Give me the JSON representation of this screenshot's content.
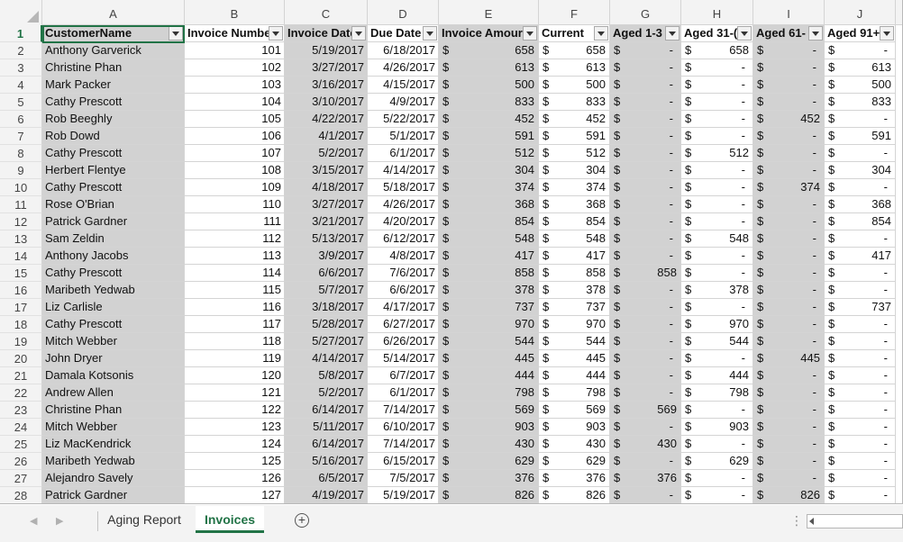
{
  "columns": [
    "A",
    "B",
    "C",
    "D",
    "E",
    "F",
    "G",
    "H",
    "I",
    "J"
  ],
  "headers": [
    "CustomerName",
    "Invoice Numbe",
    "Invoice Date",
    "Due Date",
    "Invoice Amour",
    "Current",
    "Aged 1-3",
    "Aged 31-(",
    "Aged 61-",
    "Aged 91+"
  ],
  "currency_symbol": "$",
  "rows": [
    [
      "Anthony Garverick",
      "101",
      "5/19/2017",
      "6/18/2017",
      "658",
      "658",
      "-",
      "658",
      "-",
      "-"
    ],
    [
      "Christine Phan",
      "102",
      "3/27/2017",
      "4/26/2017",
      "613",
      "613",
      "-",
      "-",
      "-",
      "613"
    ],
    [
      "Mark Packer",
      "103",
      "3/16/2017",
      "4/15/2017",
      "500",
      "500",
      "-",
      "-",
      "-",
      "500"
    ],
    [
      "Cathy Prescott",
      "104",
      "3/10/2017",
      "4/9/2017",
      "833",
      "833",
      "-",
      "-",
      "-",
      "833"
    ],
    [
      "Rob Beeghly",
      "105",
      "4/22/2017",
      "5/22/2017",
      "452",
      "452",
      "-",
      "-",
      "452",
      "-"
    ],
    [
      "Rob Dowd",
      "106",
      "4/1/2017",
      "5/1/2017",
      "591",
      "591",
      "-",
      "-",
      "-",
      "591"
    ],
    [
      "Cathy Prescott",
      "107",
      "5/2/2017",
      "6/1/2017",
      "512",
      "512",
      "-",
      "512",
      "-",
      "-"
    ],
    [
      "Herbert Flentye",
      "108",
      "3/15/2017",
      "4/14/2017",
      "304",
      "304",
      "-",
      "-",
      "-",
      "304"
    ],
    [
      "Cathy Prescott",
      "109",
      "4/18/2017",
      "5/18/2017",
      "374",
      "374",
      "-",
      "-",
      "374",
      "-"
    ],
    [
      "Rose O'Brian",
      "110",
      "3/27/2017",
      "4/26/2017",
      "368",
      "368",
      "-",
      "-",
      "-",
      "368"
    ],
    [
      "Patrick Gardner",
      "111",
      "3/21/2017",
      "4/20/2017",
      "854",
      "854",
      "-",
      "-",
      "-",
      "854"
    ],
    [
      "Sam Zeldin",
      "112",
      "5/13/2017",
      "6/12/2017",
      "548",
      "548",
      "-",
      "548",
      "-",
      "-"
    ],
    [
      "Anthony Jacobs",
      "113",
      "3/9/2017",
      "4/8/2017",
      "417",
      "417",
      "-",
      "-",
      "-",
      "417"
    ],
    [
      "Cathy Prescott",
      "114",
      "6/6/2017",
      "7/6/2017",
      "858",
      "858",
      "858",
      "-",
      "-",
      "-"
    ],
    [
      "Maribeth Yedwab",
      "115",
      "5/7/2017",
      "6/6/2017",
      "378",
      "378",
      "-",
      "378",
      "-",
      "-"
    ],
    [
      "Liz Carlisle",
      "116",
      "3/18/2017",
      "4/17/2017",
      "737",
      "737",
      "-",
      "-",
      "-",
      "737"
    ],
    [
      "Cathy Prescott",
      "117",
      "5/28/2017",
      "6/27/2017",
      "970",
      "970",
      "-",
      "970",
      "-",
      "-"
    ],
    [
      "Mitch Webber",
      "118",
      "5/27/2017",
      "6/26/2017",
      "544",
      "544",
      "-",
      "544",
      "-",
      "-"
    ],
    [
      "John Dryer",
      "119",
      "4/14/2017",
      "5/14/2017",
      "445",
      "445",
      "-",
      "-",
      "445",
      "-"
    ],
    [
      "Damala Kotsonis",
      "120",
      "5/8/2017",
      "6/7/2017",
      "444",
      "444",
      "-",
      "444",
      "-",
      "-"
    ],
    [
      "Andrew Allen",
      "121",
      "5/2/2017",
      "6/1/2017",
      "798",
      "798",
      "-",
      "798",
      "-",
      "-"
    ],
    [
      "Christine Phan",
      "122",
      "6/14/2017",
      "7/14/2017",
      "569",
      "569",
      "569",
      "-",
      "-",
      "-"
    ],
    [
      "Mitch Webber",
      "123",
      "5/11/2017",
      "6/10/2017",
      "903",
      "903",
      "-",
      "903",
      "-",
      "-"
    ],
    [
      "Liz MacKendrick",
      "124",
      "6/14/2017",
      "7/14/2017",
      "430",
      "430",
      "430",
      "-",
      "-",
      "-"
    ],
    [
      "Maribeth Yedwab",
      "125",
      "5/16/2017",
      "6/15/2017",
      "629",
      "629",
      "-",
      "629",
      "-",
      "-"
    ],
    [
      "Alejandro Savely",
      "126",
      "6/5/2017",
      "7/5/2017",
      "376",
      "376",
      "376",
      "-",
      "-",
      "-"
    ],
    [
      "Patrick Gardner",
      "127",
      "4/19/2017",
      "5/19/2017",
      "826",
      "826",
      "-",
      "-",
      "826",
      "-"
    ]
  ],
  "sheet_tabs": [
    "Aging Report",
    "Invoices"
  ],
  "active_tab": "Invoices",
  "colors": {
    "accent": "#217346",
    "grey_column": "#d2d2d2",
    "header_bg": "#f3f3f3"
  }
}
